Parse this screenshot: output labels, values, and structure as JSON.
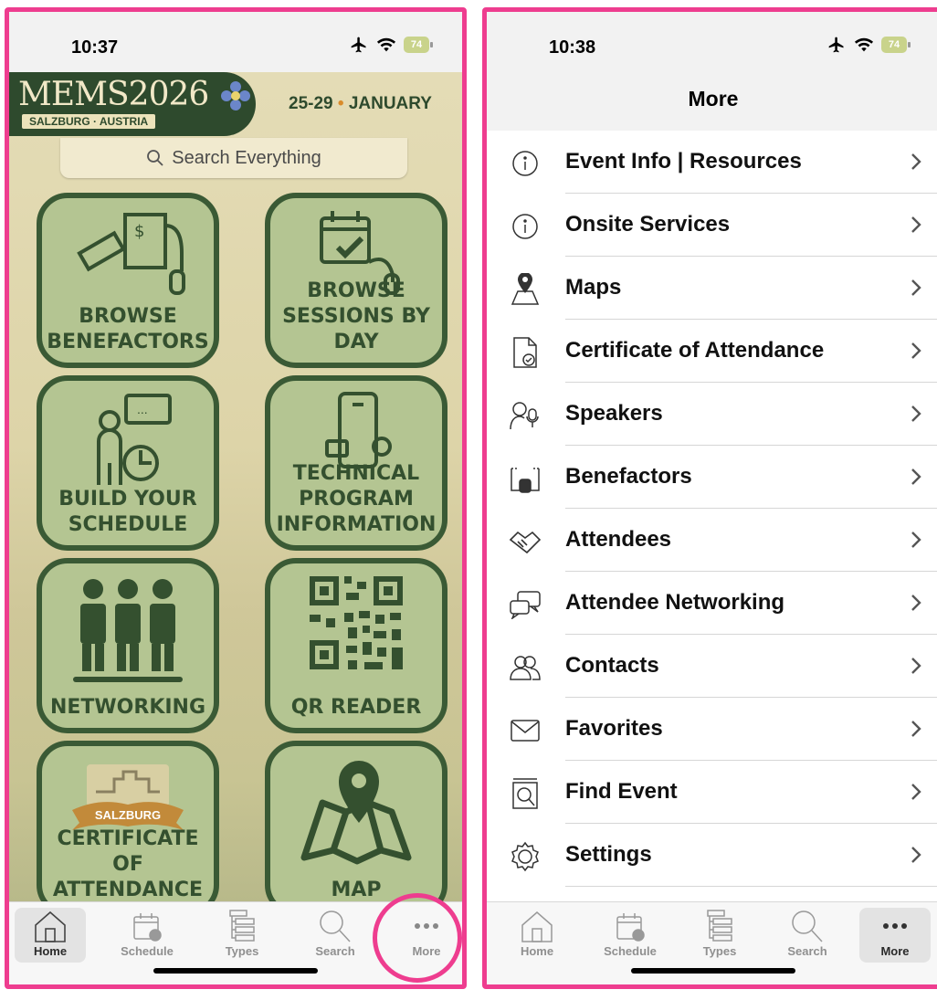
{
  "left_screen": {
    "status": {
      "time": "10:37",
      "battery": "74"
    },
    "banner": {
      "title": "MEMS2026",
      "subtitle": "SALZBURG · AUSTRIA",
      "dates": "25-29",
      "dates_dot": "•",
      "month": "JANUARY"
    },
    "search": {
      "placeholder": "Search Everything"
    },
    "tiles": [
      {
        "label": "BROWSE BENEFACTORS",
        "icon": "benefactors-icon"
      },
      {
        "label": "BROWSE SESSIONS BY DAY",
        "icon": "calendar-icon"
      },
      {
        "label": "BUILD YOUR SCHEDULE",
        "icon": "presenter-icon"
      },
      {
        "label": "TECHNICAL PROGRAM INFORMATION",
        "icon": "phone-icon"
      },
      {
        "label": "NETWORKING",
        "icon": "people-icon"
      },
      {
        "label": "QR READER",
        "icon": "qr-code-icon"
      },
      {
        "label": "CERTIFICATE OF ATTENDANCE",
        "icon": "salzburg-badge-icon"
      },
      {
        "label": "MAP",
        "icon": "map-pin-icon"
      }
    ]
  },
  "right_screen": {
    "status": {
      "time": "10:38",
      "battery": "74"
    },
    "title": "More",
    "items": [
      {
        "label": "Event Info | Resources",
        "icon": "info-icon"
      },
      {
        "label": "Onsite Services",
        "icon": "info-icon"
      },
      {
        "label": "Maps",
        "icon": "map-pin-icon"
      },
      {
        "label": "Certificate of Attendance",
        "icon": "certificate-icon"
      },
      {
        "label": "Speakers",
        "icon": "speaker-icon"
      },
      {
        "label": "Benefactors",
        "icon": "benefactors-icon"
      },
      {
        "label": "Attendees",
        "icon": "handshake-icon"
      },
      {
        "label": "Attendee Networking",
        "icon": "chat-bubbles-icon"
      },
      {
        "label": "Contacts",
        "icon": "contacts-icon"
      },
      {
        "label": "Favorites",
        "icon": "envelope-icon"
      },
      {
        "label": "Find Event",
        "icon": "find-event-icon"
      },
      {
        "label": "Settings",
        "icon": "gear-icon"
      }
    ]
  },
  "tabs": [
    {
      "label": "Home",
      "icon": "home-icon"
    },
    {
      "label": "Schedule",
      "icon": "schedule-icon"
    },
    {
      "label": "Types",
      "icon": "types-icon"
    },
    {
      "label": "Search",
      "icon": "search-icon"
    },
    {
      "label": "More",
      "icon": "more-icon"
    }
  ],
  "colors": {
    "brand_green": "#3a5a35",
    "tile_fill": "#b4c592",
    "highlight_pink": "#ee3d8f",
    "accent_orange": "#d98b2b"
  }
}
